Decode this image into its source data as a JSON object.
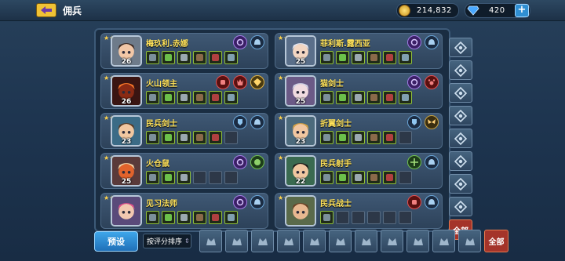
{
  "header": {
    "title": "佣兵"
  },
  "resources": {
    "coins": "214,832",
    "gems": "420"
  },
  "mercenaries": [
    {
      "name": "梅玖利.赤娜",
      "level": "26",
      "stars": 2,
      "portrait": "female-warrior-portrait",
      "skills": [
        {
          "icon": "swirl-skill-icon",
          "color": "purple"
        },
        {
          "icon": "helmet-skill-icon",
          "color": "blue"
        }
      ],
      "equipment": [
        "filled",
        "filled",
        "filled",
        "filled",
        "filled",
        "filled"
      ]
    },
    {
      "name": "菲利斯.露西亚",
      "level": "25",
      "stars": 2,
      "portrait": "silver-hair-girl-portrait",
      "skills": [
        {
          "icon": "swirl-skill-icon",
          "color": "purple"
        },
        {
          "icon": "helmet-skill-icon",
          "color": "blue"
        }
      ],
      "equipment": [
        "filled",
        "filled",
        "filled",
        "filled",
        "filled",
        "filled"
      ]
    },
    {
      "name": "火山领主",
      "level": "26",
      "stars": 3,
      "portrait": "volcano-lord-portrait",
      "skills": [
        {
          "icon": "fist-skill-icon",
          "color": "red"
        },
        {
          "icon": "demon-skill-icon",
          "color": "red"
        },
        {
          "icon": "crest-skill-icon",
          "color": "gold"
        }
      ],
      "equipment": [
        "filled",
        "filled",
        "filled",
        "filled",
        "filled",
        "filled"
      ]
    },
    {
      "name": "猫剑士",
      "level": "25",
      "stars": 2,
      "portrait": "cat-swordsman-portrait",
      "skills": [
        {
          "icon": "swirl-skill-icon",
          "color": "purple"
        },
        {
          "icon": "paw-skill-icon",
          "color": "red"
        }
      ],
      "equipment": [
        "filled",
        "filled",
        "filled",
        "filled",
        "filled",
        "filled"
      ]
    },
    {
      "name": "民兵剑士",
      "level": "23",
      "stars": 2,
      "portrait": "militia-swordsman-portrait",
      "skills": [
        {
          "icon": "shield-man-skill-icon",
          "color": "blue"
        },
        {
          "icon": "helmet-skill-icon",
          "color": "blue"
        }
      ],
      "equipment": [
        "filled",
        "filled",
        "filled",
        "filled",
        "filled",
        "empty"
      ]
    },
    {
      "name": "折翼剑士",
      "level": "23",
      "stars": 2,
      "portrait": "broken-wing-swordsman-portrait",
      "skills": [
        {
          "icon": "shield-man-skill-icon",
          "color": "blue"
        },
        {
          "icon": "wings-skill-icon",
          "color": "amber"
        }
      ],
      "equipment": [
        "filled",
        "filled",
        "filled",
        "filled",
        "filled",
        "empty"
      ]
    },
    {
      "name": "火仓鼠",
      "level": "25",
      "stars": 2,
      "portrait": "fire-hamster-portrait",
      "skills": [
        {
          "icon": "swirl-skill-icon",
          "color": "purple"
        },
        {
          "icon": "beast-skill-icon",
          "color": "green"
        }
      ],
      "equipment": [
        "filled",
        "filled",
        "filled",
        "empty",
        "empty",
        "empty"
      ]
    },
    {
      "name": "民兵射手",
      "level": "22",
      "stars": 2,
      "portrait": "militia-archer-portrait",
      "skills": [
        {
          "icon": "crossbow-skill-icon",
          "color": "green"
        },
        {
          "icon": "helmet-skill-icon",
          "color": "blue"
        }
      ],
      "equipment": [
        "filled",
        "filled",
        "filled",
        "filled",
        "filled",
        "empty"
      ]
    },
    {
      "name": "见习法师",
      "level": "",
      "stars": 2,
      "portrait": "apprentice-mage-portrait",
      "skills": [
        {
          "icon": "swirl-skill-icon",
          "color": "purple"
        },
        {
          "icon": "helmet-skill-icon",
          "color": "blue"
        }
      ],
      "equipment": [
        "filled",
        "filled",
        "filled",
        "filled",
        "filled",
        "filled"
      ]
    },
    {
      "name": "民兵战士",
      "level": "",
      "stars": 2,
      "portrait": "militia-warrior-portrait",
      "skills": [
        {
          "icon": "fist-skill-icon",
          "color": "red"
        },
        {
          "icon": "helmet-skill-icon",
          "color": "blue"
        }
      ],
      "equipment": [
        "filled",
        "empty",
        "empty",
        "empty",
        "empty",
        "empty"
      ]
    }
  ],
  "side_filters": [
    "spiral-class-icon",
    "cross-class-icon",
    "arrow-class-icon",
    "star-class-icon",
    "shield-class-icon",
    "bow-class-icon",
    "tower-class-icon",
    "hammer-class-icon"
  ],
  "side_filter_all": "全部",
  "bottom": {
    "preset_label": "预设",
    "sort_label": "按评分排序",
    "sort_arrow": "⇕",
    "race_filters": [
      "beast-race-icon",
      "horned-race-icon",
      "skull-race-icon",
      "elf-race-icon",
      "dragon-race-icon",
      "golem-race-icon",
      "crown-race-icon",
      "wolf-race-icon",
      "knight-race-icon",
      "armor-race-icon",
      "helm-race-icon"
    ],
    "all_label": "全部"
  }
}
